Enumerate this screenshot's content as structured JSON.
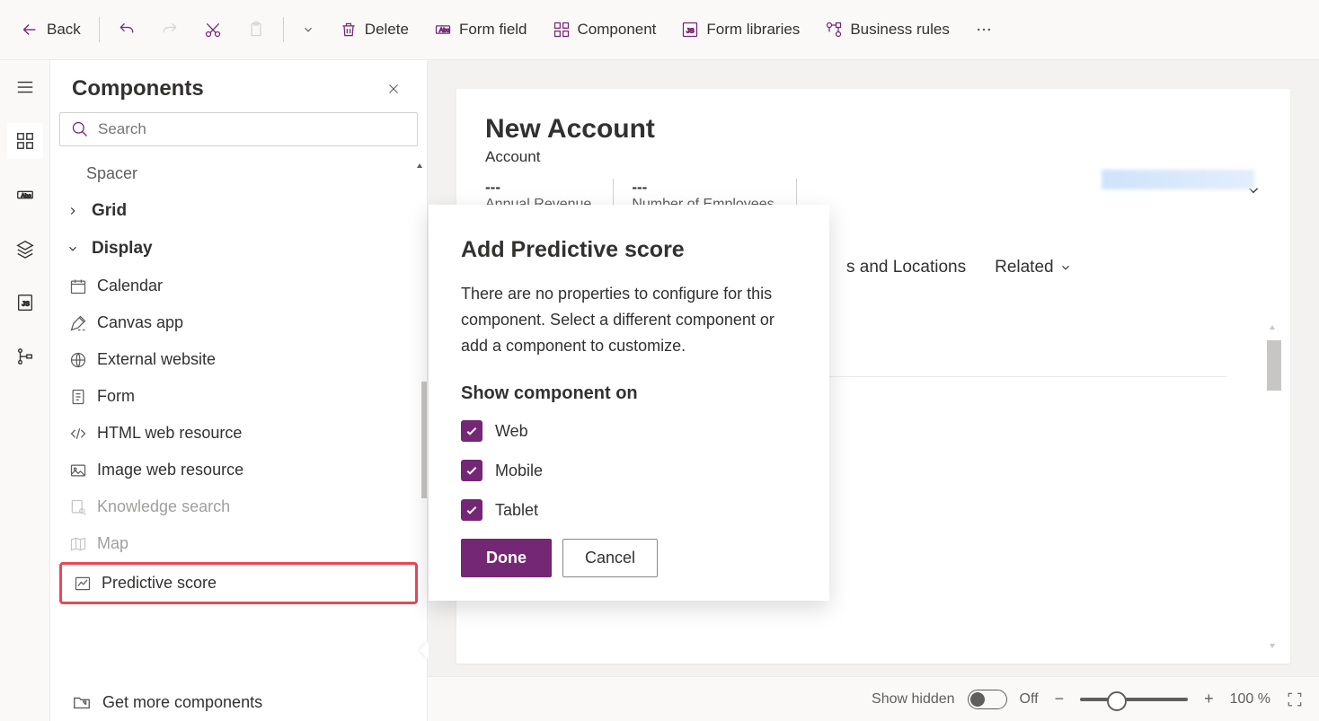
{
  "toolbar": {
    "back": "Back",
    "delete": "Delete",
    "form_field": "Form field",
    "component": "Component",
    "form_libraries": "Form libraries",
    "business_rules": "Business rules"
  },
  "panel": {
    "title": "Components",
    "search_placeholder": "Search",
    "tree": {
      "spacer": "Spacer",
      "grid": "Grid",
      "display": "Display",
      "items": {
        "calendar": "Calendar",
        "canvas_app": "Canvas app",
        "external_website": "External website",
        "form": "Form",
        "html_resource": "HTML web resource",
        "image_resource": "Image web resource",
        "knowledge_search": "Knowledge search",
        "map": "Map",
        "predictive_score": "Predictive score"
      }
    },
    "get_more": "Get more components"
  },
  "form": {
    "title": "New Account",
    "subtitle": "Account",
    "fields": {
      "revenue_value": "---",
      "revenue_label": "Annual Revenue",
      "employees_value": "---",
      "employees_label": "Number of Employees"
    },
    "tabs": {
      "addresses": "s and Locations",
      "related": "Related"
    }
  },
  "dialog": {
    "title": "Add Predictive score",
    "desc": "There are no properties to configure for this component. Select a different component or add a component to customize.",
    "section": "Show component on",
    "options": {
      "web": "Web",
      "mobile": "Mobile",
      "tablet": "Tablet"
    },
    "done": "Done",
    "cancel": "Cancel"
  },
  "bottombar": {
    "show_hidden": "Show hidden",
    "off": "Off",
    "zoom": "100 %"
  }
}
